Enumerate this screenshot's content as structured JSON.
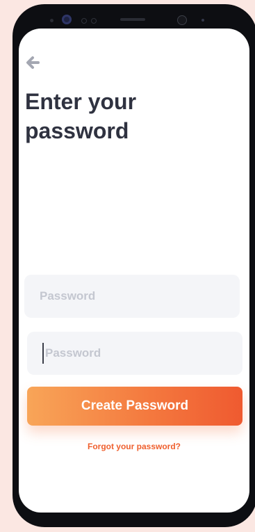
{
  "screen": {
    "title_line1": "Enter your",
    "title_line2": "password",
    "back_icon": "arrow-left-icon"
  },
  "fields": {
    "password_placeholder": "Password",
    "confirm_placeholder": "Password"
  },
  "actions": {
    "create_label": "Create Password",
    "forgot_label": "Forgot your password?"
  },
  "colors": {
    "accent_start": "#f8a558",
    "accent_end": "#ef5a30",
    "title": "#2f3240",
    "link": "#ef5f2d",
    "field_bg": "#f4f5f8"
  }
}
